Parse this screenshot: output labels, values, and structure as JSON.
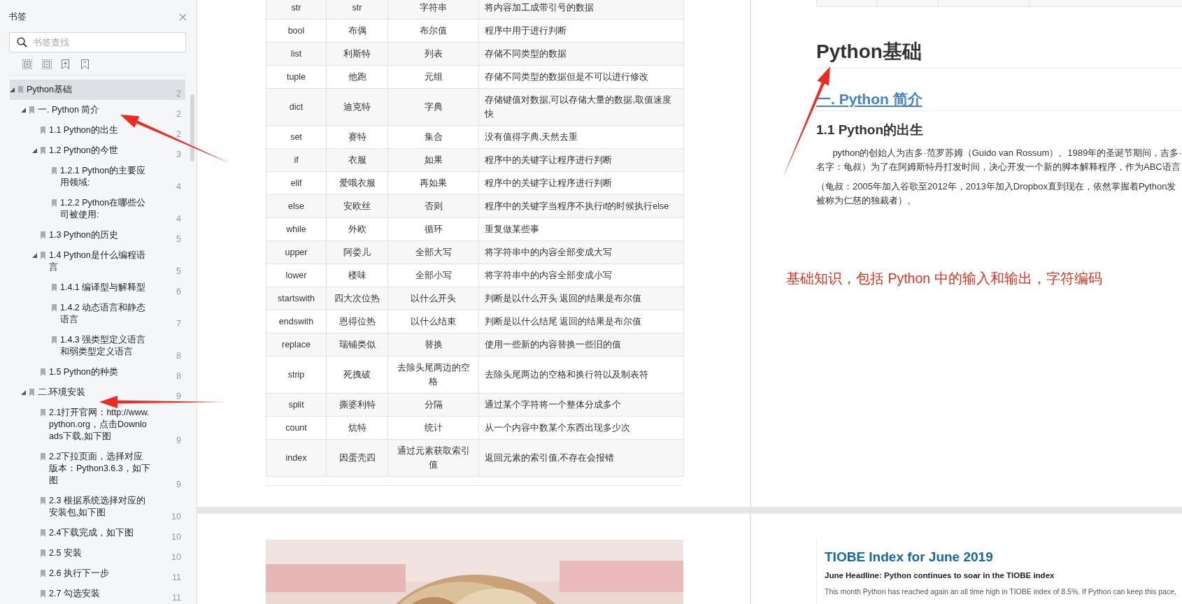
{
  "sidebar": {
    "title": "书签",
    "search": {
      "placeholder": "书签查找"
    },
    "tree": [
      {
        "label": "Python基础",
        "page": "2",
        "selected": true,
        "expanded": true,
        "children": [
          {
            "label": "一. Python 简介",
            "page": "2",
            "selected": false,
            "expanded": true,
            "children": [
              {
                "label": "1.1 Python的出生",
                "page": "2",
                "selected": false
              },
              {
                "label": "1.2 Python的今世",
                "page": "3",
                "selected": false,
                "expanded": true,
                "children": [
                  {
                    "label": "1.2.1 Python的主要应用领域:",
                    "page": "4",
                    "selected": false
                  },
                  {
                    "label": "1.2.2 Python在哪些公司被使用:",
                    "page": "4",
                    "selected": false
                  }
                ]
              },
              {
                "label": "1.3 Python的历史",
                "page": "5",
                "selected": false
              },
              {
                "label": "1.4  Python是什么编程语言",
                "page": "5",
                "selected": false,
                "expanded": true,
                "children": [
                  {
                    "label": "1.4.1 编译型与解释型",
                    "page": "6",
                    "selected": false
                  },
                  {
                    "label": "1.4.2 动态语言和静态语言",
                    "page": "7",
                    "selected": false
                  },
                  {
                    "label": "1.4.3 强类型定义语言和弱类型定义语言",
                    "page": "8",
                    "selected": false
                  }
                ]
              },
              {
                "label": "1.5 Python的种类",
                "page": "8",
                "selected": false
              }
            ]
          },
          {
            "label": "二.环境安装",
            "page": "9",
            "selected": false,
            "expanded": true,
            "children": [
              {
                "label": "2.1打开官网：http://www.python.org，点击Downloads下载,如下图",
                "page": "9",
                "selected": false
              },
              {
                "label": "2.2下拉页面，选择对应版本：Python3.6.3，如下图",
                "page": "9",
                "selected": false
              },
              {
                "label": "2.3  根据系统选择对应的安装包,如下图",
                "page": "10",
                "selected": false
              },
              {
                "label": "2.4下载完成，如下图",
                "page": "10",
                "selected": false
              },
              {
                "label": "2.5 安装",
                "page": "10",
                "selected": false
              },
              {
                "label": "2.6 执行下一步",
                "page": "11",
                "selected": false
              },
              {
                "label": "2.7 勾选安装",
                "page": "11",
                "selected": false
              }
            ]
          }
        ]
      }
    ]
  },
  "left_page": {
    "table": {
      "rows": [
        [
          "str",
          "str",
          "字符串",
          "将内容加工成带引号的数据"
        ],
        [
          "bool",
          "布偶",
          "布尔值",
          "程序中用于进行判断"
        ],
        [
          "list",
          "利斯特",
          "列表",
          "存储不同类型的数据"
        ],
        [
          "tuple",
          "他跑",
          "元组",
          "存储不同类型的数据但是不可以进行修改"
        ],
        [
          "dict",
          "迪克特",
          "字典",
          "存储键值对数据,可以存储大量的数据,取值速度快"
        ],
        [
          "set",
          "赛特",
          "集合",
          "没有值得字典,天然去重"
        ],
        [
          "if",
          "衣服",
          "如果",
          "程序中的关键字让程序进行判断"
        ],
        [
          "elif",
          "爱哦衣服",
          "再如果",
          "程序中的关键字让程序进行判断"
        ],
        [
          "else",
          "安欧丝",
          "否则",
          "程序中的关键字当程序不执行if的时候执行else"
        ],
        [
          "while",
          "外欧",
          "循环",
          "重复做某些事"
        ],
        [
          "upper",
          "阿娄儿",
          "全部大写",
          "将字符串中的内容全部变成大写"
        ],
        [
          "lower",
          "楼味",
          "全部小写",
          "将字符串中的内容全部变成小写"
        ],
        [
          "startswith",
          "四大次位热",
          "以什么开头",
          "判断是以什么开头 返回的结果是布尔值"
        ],
        [
          "endswith",
          "恩得位热",
          "以什么结束",
          "判断是以什么结尾 返回的结果是布尔值"
        ],
        [
          "replace",
          "瑞铺类似",
          "替换",
          "使用一些新的内容替换一些旧的值"
        ],
        [
          "strip",
          "死拽破",
          "去除头尾两边的空格",
          "去除头尾两边的空格和换行符以及制表符"
        ],
        [
          "split",
          "撕婆利特",
          "分隔",
          "通过某个字符将一个整体分成多个"
        ],
        [
          "count",
          "炕特",
          "统计",
          "从一个内容中数某个东西出现多少次"
        ],
        [
          "index",
          "因蛋壳四",
          "通过元素获取索引值",
          "返回元素的索引值,不存在会报错"
        ]
      ]
    }
  },
  "right_page": {
    "heading": "Python基础",
    "section": "一. Python 简介",
    "subsection": "1.1 Python的出生",
    "paragraphs": [
      [
        "python的创始人为吉多·范罗苏姆（Guido van Rossum）。1989年的圣诞节期间，吉多·",
        "名字：龟叔）为了在阿姆斯特丹打发时间，决心开发一个新的脚本解释程序，作为ABC语言"
      ],
      [
        "（龟叔：2005年加入谷歌至2012年，2013年加入Dropbox直到现在，依然掌握着Python发",
        "被称为仁慈的独裁者）。"
      ]
    ],
    "annotation": "基础知识，包括 Python 中的输入和输出，字符编码",
    "tiobe": {
      "title": "TIOBE Index for June 2019",
      "headline": "June Headline: Python continues to soar in the TIOBE index",
      "body": "This month Python has reached again an all time high in TIOBE index of 8.5%. If Python can keep this pace,"
    }
  }
}
